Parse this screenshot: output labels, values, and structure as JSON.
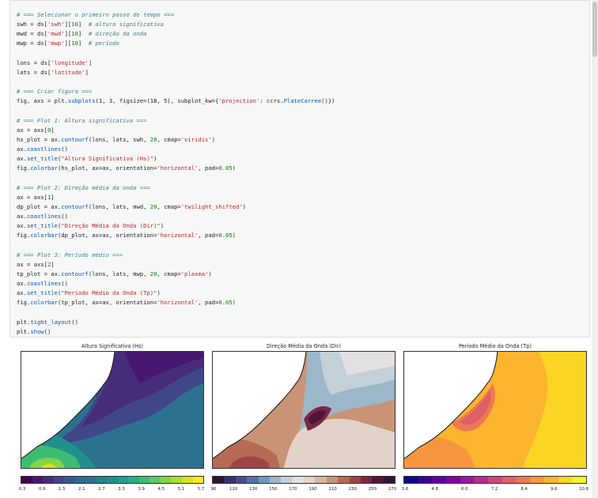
{
  "code_lines": [
    {
      "seg": [
        {
          "t": "c",
          "v": "# === Selecionar o primeiro passo de tempo ==="
        }
      ]
    },
    {
      "seg": [
        {
          "t": "p",
          "v": "swh = ds["
        },
        {
          "t": "s",
          "v": "'swh'"
        },
        {
          "t": "p",
          "v": "]["
        },
        {
          "t": "n",
          "v": "10"
        },
        {
          "t": "p",
          "v": "]  "
        },
        {
          "t": "c",
          "v": "# altura significativa"
        }
      ]
    },
    {
      "seg": [
        {
          "t": "p",
          "v": "mwd = ds["
        },
        {
          "t": "s",
          "v": "'mwd'"
        },
        {
          "t": "p",
          "v": "]["
        },
        {
          "t": "n",
          "v": "10"
        },
        {
          "t": "p",
          "v": "]  "
        },
        {
          "t": "c",
          "v": "# direção da onda"
        }
      ]
    },
    {
      "seg": [
        {
          "t": "p",
          "v": "mwp = ds["
        },
        {
          "t": "s",
          "v": "'mwp'"
        },
        {
          "t": "p",
          "v": "]["
        },
        {
          "t": "n",
          "v": "10"
        },
        {
          "t": "p",
          "v": "]  "
        },
        {
          "t": "c",
          "v": "# período"
        }
      ]
    },
    {
      "seg": [
        {
          "t": "p",
          "v": ""
        }
      ]
    },
    {
      "seg": [
        {
          "t": "p",
          "v": "lons = ds["
        },
        {
          "t": "s",
          "v": "'longitude'"
        },
        {
          "t": "p",
          "v": "]"
        }
      ]
    },
    {
      "seg": [
        {
          "t": "p",
          "v": "lats = ds["
        },
        {
          "t": "s",
          "v": "'latitude'"
        },
        {
          "t": "p",
          "v": "]"
        }
      ]
    },
    {
      "seg": [
        {
          "t": "p",
          "v": ""
        }
      ]
    },
    {
      "seg": [
        {
          "t": "c",
          "v": "# === Criar figura ==="
        }
      ]
    },
    {
      "seg": [
        {
          "t": "p",
          "v": "fig, axs = plt."
        },
        {
          "t": "f",
          "v": "subplots"
        },
        {
          "t": "p",
          "v": "(1, 3, figsize=(18, 5), subplot_kw={"
        },
        {
          "t": "s",
          "v": "'projection'"
        },
        {
          "t": "p",
          "v": ": ccrs."
        },
        {
          "t": "f",
          "v": "PlateCarree"
        },
        {
          "t": "p",
          "v": "()})"
        }
      ]
    },
    {
      "seg": [
        {
          "t": "p",
          "v": ""
        }
      ]
    },
    {
      "seg": [
        {
          "t": "c",
          "v": "# === Plot 1: Altura significativa ==="
        }
      ]
    },
    {
      "seg": [
        {
          "t": "p",
          "v": "ax = axs["
        },
        {
          "t": "n",
          "v": "0"
        },
        {
          "t": "p",
          "v": "]"
        }
      ]
    },
    {
      "seg": [
        {
          "t": "p",
          "v": "hs_plot = ax."
        },
        {
          "t": "f",
          "v": "contourf"
        },
        {
          "t": "p",
          "v": "(lons, lats, swh, "
        },
        {
          "t": "n",
          "v": "20"
        },
        {
          "t": "p",
          "v": ", cmap="
        },
        {
          "t": "s",
          "v": "'viridis'"
        },
        {
          "t": "p",
          "v": ")"
        }
      ]
    },
    {
      "seg": [
        {
          "t": "p",
          "v": "ax."
        },
        {
          "t": "f",
          "v": "coastlines"
        },
        {
          "t": "p",
          "v": "()"
        }
      ]
    },
    {
      "seg": [
        {
          "t": "p",
          "v": "ax."
        },
        {
          "t": "f",
          "v": "set_title"
        },
        {
          "t": "p",
          "v": "("
        },
        {
          "t": "s",
          "v": "\"Altura Significativa (Hs)\""
        },
        {
          "t": "p",
          "v": ")"
        }
      ]
    },
    {
      "seg": [
        {
          "t": "p",
          "v": "fig."
        },
        {
          "t": "f",
          "v": "colorbar"
        },
        {
          "t": "p",
          "v": "(hs_plot, ax=ax, orientation="
        },
        {
          "t": "s",
          "v": "'horizontal'"
        },
        {
          "t": "p",
          "v": ", pad="
        },
        {
          "t": "n",
          "v": "0.05"
        },
        {
          "t": "p",
          "v": ")"
        }
      ]
    },
    {
      "seg": [
        {
          "t": "p",
          "v": ""
        }
      ]
    },
    {
      "seg": [
        {
          "t": "c",
          "v": "# === Plot 2: Direção média da onda ==="
        }
      ]
    },
    {
      "seg": [
        {
          "t": "p",
          "v": "ax = axs["
        },
        {
          "t": "n",
          "v": "1"
        },
        {
          "t": "p",
          "v": "]"
        }
      ]
    },
    {
      "seg": [
        {
          "t": "p",
          "v": "dp_plot = ax."
        },
        {
          "t": "f",
          "v": "contourf"
        },
        {
          "t": "p",
          "v": "(lons, lats, mwd, "
        },
        {
          "t": "n",
          "v": "20"
        },
        {
          "t": "p",
          "v": ", cmap="
        },
        {
          "t": "s",
          "v": "'twilight_shifted'"
        },
        {
          "t": "p",
          "v": ")"
        }
      ]
    },
    {
      "seg": [
        {
          "t": "p",
          "v": "ax."
        },
        {
          "t": "f",
          "v": "coastlines"
        },
        {
          "t": "p",
          "v": "()"
        }
      ]
    },
    {
      "seg": [
        {
          "t": "p",
          "v": "ax."
        },
        {
          "t": "f",
          "v": "set_title"
        },
        {
          "t": "p",
          "v": "("
        },
        {
          "t": "s",
          "v": "\"Direção Média da Onda (Dir)\""
        },
        {
          "t": "p",
          "v": ")"
        }
      ]
    },
    {
      "seg": [
        {
          "t": "p",
          "v": "fig."
        },
        {
          "t": "f",
          "v": "colorbar"
        },
        {
          "t": "p",
          "v": "(dp_plot, ax=ax, orientation="
        },
        {
          "t": "s",
          "v": "'horizontal'"
        },
        {
          "t": "p",
          "v": ", pad="
        },
        {
          "t": "n",
          "v": "0.05"
        },
        {
          "t": "p",
          "v": ")"
        }
      ]
    },
    {
      "seg": [
        {
          "t": "p",
          "v": ""
        }
      ]
    },
    {
      "seg": [
        {
          "t": "c",
          "v": "# === Plot 3: Período médio ==="
        }
      ]
    },
    {
      "seg": [
        {
          "t": "p",
          "v": "ax = axs["
        },
        {
          "t": "n",
          "v": "2"
        },
        {
          "t": "p",
          "v": "]"
        }
      ]
    },
    {
      "seg": [
        {
          "t": "p",
          "v": "tp_plot = ax."
        },
        {
          "t": "f",
          "v": "contourf"
        },
        {
          "t": "p",
          "v": "(lons, lats, mwp, "
        },
        {
          "t": "n",
          "v": "20"
        },
        {
          "t": "p",
          "v": ", cmap="
        },
        {
          "t": "s",
          "v": "'plasma'"
        },
        {
          "t": "p",
          "v": ")"
        }
      ]
    },
    {
      "seg": [
        {
          "t": "p",
          "v": "ax."
        },
        {
          "t": "f",
          "v": "coastlines"
        },
        {
          "t": "p",
          "v": "()"
        }
      ]
    },
    {
      "seg": [
        {
          "t": "p",
          "v": "ax."
        },
        {
          "t": "f",
          "v": "set_title"
        },
        {
          "t": "p",
          "v": "("
        },
        {
          "t": "s",
          "v": "\"Período Médio da Onda (Tp)\""
        },
        {
          "t": "p",
          "v": ")"
        }
      ]
    },
    {
      "seg": [
        {
          "t": "p",
          "v": "fig."
        },
        {
          "t": "f",
          "v": "colorbar"
        },
        {
          "t": "p",
          "v": "(tp_plot, ax=ax, orientation="
        },
        {
          "t": "s",
          "v": "'horizontal'"
        },
        {
          "t": "p",
          "v": ", pad="
        },
        {
          "t": "n",
          "v": "0.05"
        },
        {
          "t": "p",
          "v": ")"
        }
      ]
    },
    {
      "seg": [
        {
          "t": "p",
          "v": ""
        }
      ]
    },
    {
      "seg": [
        {
          "t": "p",
          "v": "plt."
        },
        {
          "t": "f",
          "v": "tight_layout"
        },
        {
          "t": "p",
          "v": "()"
        }
      ]
    },
    {
      "seg": [
        {
          "t": "p",
          "v": "plt."
        },
        {
          "t": "f",
          "v": "show"
        },
        {
          "t": "p",
          "v": "()"
        }
      ]
    }
  ],
  "panels": [
    {
      "title": "Altura Significativa (Hs)",
      "cmap": "viridis",
      "cmap_colors": [
        "#440154",
        "#46186f",
        "#472c7a",
        "#3f4788",
        "#39568c",
        "#31688e",
        "#2c728e",
        "#26828e",
        "#21918c",
        "#1fa088",
        "#28ae80",
        "#3fbc73",
        "#5ec962",
        "#84d44b",
        "#addc30",
        "#d8e219",
        "#fde725"
      ],
      "ticks": [
        "0.3",
        "0.9",
        "1.5",
        "2.1",
        "2.7",
        "3.3",
        "3.9",
        "4.5",
        "5.1",
        "5.7"
      ]
    },
    {
      "title": "Direção Média da Onda (Dir)",
      "cmap": "twilight_shifted",
      "cmap_colors": [
        "#2f1436",
        "#3d2d6a",
        "#4a4c90",
        "#5573a8",
        "#6f98bb",
        "#9bb7c9",
        "#c3d0d7",
        "#e2e0e1",
        "#e3d2c9",
        "#d9b7a0",
        "#c99376",
        "#b76a55",
        "#9e4447",
        "#7a2841",
        "#4f1538",
        "#301437"
      ],
      "ticks": [
        "90",
        "110",
        "130",
        "150",
        "170",
        "190",
        "210",
        "230",
        "250",
        "270"
      ]
    },
    {
      "title": "Período Médio da Onda (Tp)",
      "cmap": "plasma",
      "cmap_colors": [
        "#0d0887",
        "#3a049a",
        "#5c01a6",
        "#7e03a8",
        "#9c179e",
        "#b42e8e",
        "#cc4778",
        "#de5f65",
        "#ed7953",
        "#f89540",
        "#fdb42f",
        "#fbd524",
        "#f0f921"
      ],
      "ticks": [
        "3.6",
        "4.8",
        "6.0",
        "7.2",
        "8.4",
        "9.6",
        "10.8"
      ]
    }
  ]
}
